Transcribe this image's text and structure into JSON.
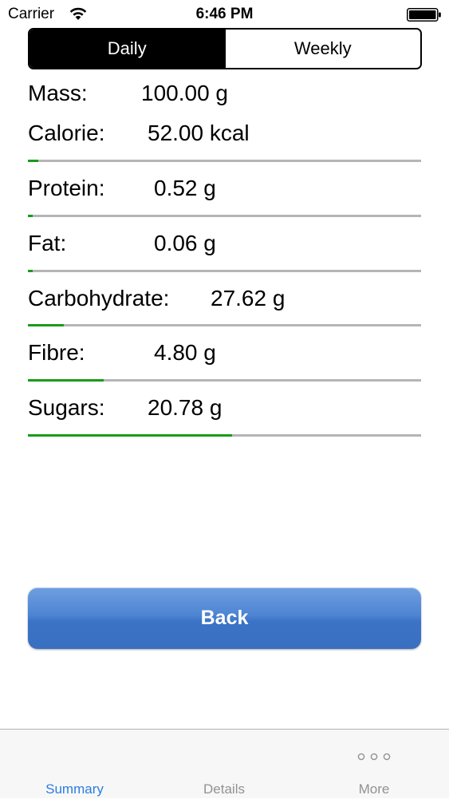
{
  "status_bar": {
    "carrier": "Carrier",
    "time": "6:46 PM"
  },
  "segmented_control": {
    "options": [
      "Daily",
      "Weekly"
    ],
    "selected": "Daily"
  },
  "nutrients": [
    {
      "label": "Mass:",
      "value": "100.00 g",
      "progress": null
    },
    {
      "label": "Calorie:",
      "value": "52.00 kcal",
      "progress": 0.026
    },
    {
      "label": "Protein:",
      "value": "0.52 g",
      "progress": 0.012
    },
    {
      "label": "Fat:",
      "value": "0.06 g",
      "progress": 0.012
    },
    {
      "label": "Carbohydrate:",
      "value": "27.62 g",
      "progress": 0.092
    },
    {
      "label": "Fibre:",
      "value": "4.80 g",
      "progress": 0.192
    },
    {
      "label": "Sugars:",
      "value": "20.78 g",
      "progress": 0.519
    }
  ],
  "back_button": {
    "label": "Back"
  },
  "tab_bar": {
    "tabs": [
      {
        "label": "Summary",
        "icon": null,
        "active": true
      },
      {
        "label": "Details",
        "icon": null,
        "active": false
      },
      {
        "label": "More",
        "icon": "more-dots-icon",
        "active": false
      }
    ]
  },
  "colors": {
    "progress_fill": "#1a9b1a",
    "progress_track": "#b5b5b5",
    "tab_active": "#2b7de0",
    "tab_inactive": "#929292",
    "button_blue": "#4a80cf"
  }
}
